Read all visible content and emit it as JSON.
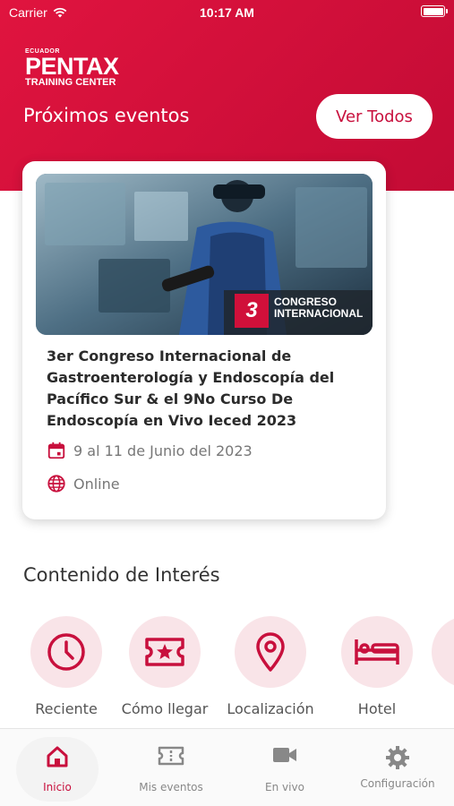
{
  "status_bar": {
    "carrier": "Carrier",
    "time": "10:17 AM"
  },
  "brand": {
    "logo_top": "ECUADOR",
    "logo_main": "PENTAX",
    "logo_sub": "TRAINING CENTER"
  },
  "header": {
    "section_title": "Próximos eventos",
    "view_all_label": "Ver Todos"
  },
  "event": {
    "image_caption_number": "3",
    "image_caption_line1": "CONGRESO",
    "image_caption_line2": "INTERNACIONAL",
    "title": "3er Congreso Internacional de Gastroenterología y Endoscopía del Pacífico Sur & el 9No Curso De Endoscopía en Vivo Ieced 2023",
    "date": "9 al 11 de Junio del 2023",
    "location": "Online"
  },
  "interest": {
    "title": "Contenido de Interés",
    "items": [
      {
        "label": "Reciente",
        "icon": "clock-icon"
      },
      {
        "label": "Cómo llegar",
        "icon": "ticket-icon"
      },
      {
        "label": "Localización",
        "icon": "location-pin-icon"
      },
      {
        "label": "Hotel",
        "icon": "bed-icon"
      }
    ]
  },
  "tabs": [
    {
      "label": "Inicio",
      "icon": "home-icon",
      "active": true
    },
    {
      "label": "Mis eventos",
      "icon": "ticket-icon",
      "active": false
    },
    {
      "label": "En vivo",
      "icon": "video-camera-icon",
      "active": false
    },
    {
      "label": "Configuración",
      "icon": "gear-icon",
      "active": false
    }
  ],
  "colors": {
    "accent": "#c8103d",
    "accent_light": "#f9e4e8",
    "tab_inactive": "#888888"
  }
}
